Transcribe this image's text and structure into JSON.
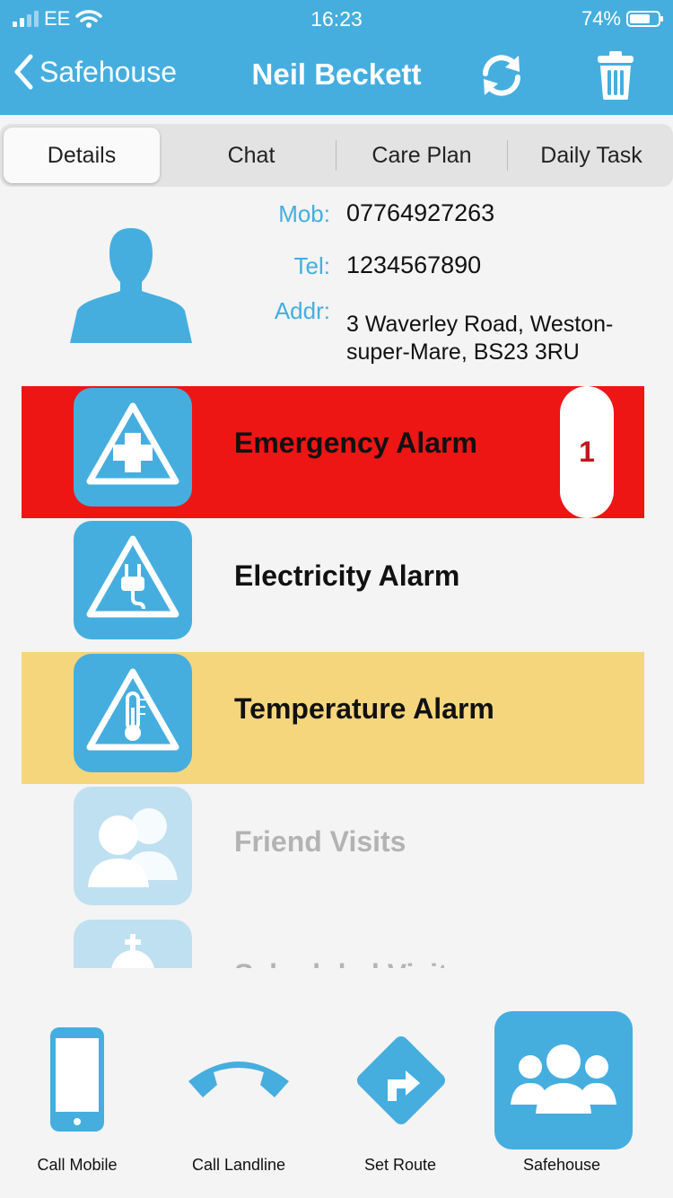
{
  "status": {
    "carrier": "EE",
    "time": "16:23",
    "battery": "74%",
    "battery_level": 0.74
  },
  "nav": {
    "back_label": "Safehouse",
    "title": "Neil Beckett",
    "refresh_icon": "refresh-icon",
    "trash_icon": "trash-icon"
  },
  "tabs": [
    {
      "label": "Details",
      "active": true
    },
    {
      "label": "Chat"
    },
    {
      "label": "Care Plan"
    },
    {
      "label": "Daily Task"
    }
  ],
  "contact": {
    "mob_label": "Mob:",
    "mob": "07764927263",
    "tel_label": "Tel:",
    "tel": "1234567890",
    "addr_label": "Addr:",
    "addr": "3 Waverley Road, Weston-super-Mare, BS23 3RU"
  },
  "alarms": [
    {
      "label": "Emergency Alarm",
      "icon": "medical-cross-warning-icon",
      "background": "#ee1515",
      "count": "1"
    },
    {
      "label": "Electricity Alarm",
      "icon": "electric-plug-warning-icon",
      "background": "#f4f4f4"
    },
    {
      "label": "Temperature Alarm",
      "icon": "thermometer-warning-icon",
      "background": "#f5d67d"
    },
    {
      "label": "Friend Visits",
      "icon": "friends-icon",
      "background": "#f4f4f4",
      "faded": true
    },
    {
      "label": "Scheduled Visits",
      "icon": "scheduled-visit-icon",
      "background": "#f4f4f4",
      "faded": true
    }
  ],
  "bottom_bar": [
    {
      "label": "Call Mobile",
      "icon": "mobile-phone-icon"
    },
    {
      "label": "Call Landline",
      "icon": "landline-phone-icon"
    },
    {
      "label": "Set Route",
      "icon": "route-sign-icon"
    },
    {
      "label": "Safehouse",
      "icon": "group-icon",
      "active": true
    }
  ],
  "colors": {
    "accent": "#45aedf",
    "emergency": "#ee1515",
    "warning": "#f5d67d",
    "badge_text": "#c0171e"
  }
}
